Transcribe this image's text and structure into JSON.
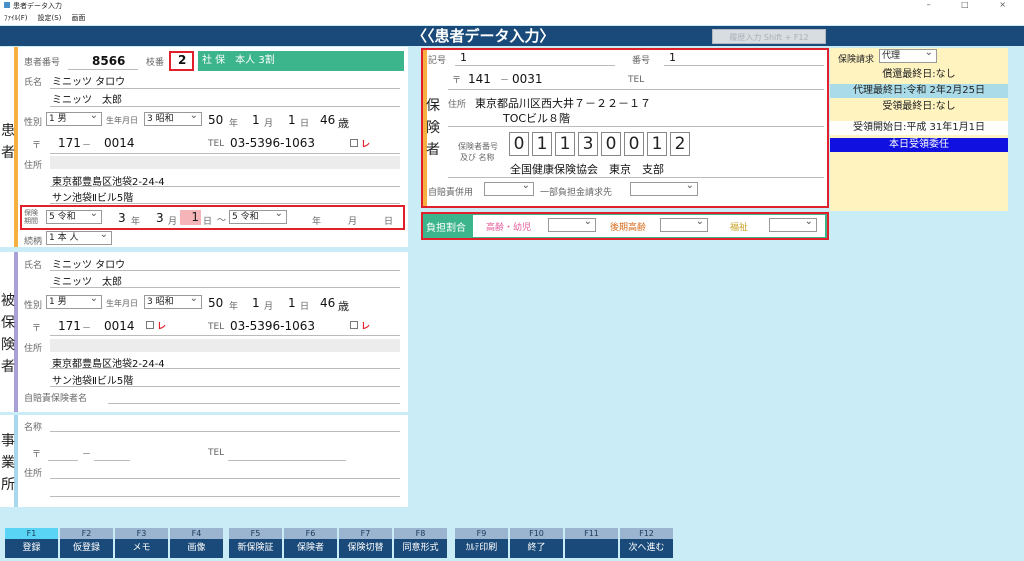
{
  "window": {
    "title": "患者データ入力",
    "controls": "– □ ×"
  },
  "menu": [
    "ﾌｧｲﾙ(F)",
    "設定(S)",
    "画面"
  ],
  "header": {
    "title": "〈〈患者データ入力〉",
    "history_button": "履歴入力 Shift + F12"
  },
  "patient": {
    "section": "患者",
    "no_label": "患者番号",
    "no": "8566",
    "branch_label": "枝番",
    "branch": "2",
    "insurance_badge": "社 保　本人 3割",
    "name_label": "氏名",
    "kana": "ミニッツ タロウ",
    "kanji": "ミニッツ　太郎",
    "sex_label": "性別",
    "sex": "1 男",
    "birth_label": "生年月日",
    "era": "3 昭和",
    "birth_year": "50",
    "year_unit": "年",
    "birth_month": "1",
    "month_unit": "月",
    "birth_day": "1",
    "day_unit": "日",
    "age": "46",
    "age_unit": "歳",
    "zip_mark": "〒",
    "zip1": "171",
    "dash": "－",
    "zip2": "0014",
    "tel_label": "TEL",
    "tel": "03-5396-1063",
    "check_mark": "レ",
    "addr_label": "住所",
    "addr1": "東京都豊島区池袋2-24-4",
    "addr2": "サン池袋Ⅱビル5階",
    "period_label": "保険期間",
    "period_era": "5 令和",
    "p_year": "3",
    "p_month": "3",
    "p_day": "1",
    "to_dash": "～",
    "end_era": "5 令和",
    "end_year_unit": "年",
    "end_month_unit": "月",
    "end_day_unit": "日",
    "relation_label": "続柄",
    "relation": "1 本 人"
  },
  "insured": {
    "section": "被保険者",
    "name_label": "氏名",
    "kana": "ミニッツ タロウ",
    "kanji": "ミニッツ　太郎",
    "sex_label": "性別",
    "sex": "1 男",
    "birth_label": "生年月日",
    "era": "3 昭和",
    "birth_year": "50",
    "year_unit": "年",
    "birth_month": "1",
    "month_unit": "月",
    "birth_day": "1",
    "day_unit": "日",
    "age": "46",
    "age_unit": "歳",
    "zip_mark": "〒",
    "zip1": "171",
    "dash": "－",
    "zip2": "0014",
    "tel_label": "TEL",
    "tel": "03-5396-1063",
    "check_mark": "レ",
    "addr_label": "住所",
    "addr1": "東京都豊島区池袋2-24-4",
    "addr2": "サン池袋Ⅱビル5階",
    "self_ins_label": "自賠責保険者名"
  },
  "workplace": {
    "section": "事業所",
    "name_label": "名称",
    "zip_mark": "〒",
    "dash": "－",
    "tel_label": "TEL",
    "addr_label": "住所"
  },
  "insurer": {
    "section": "保険者",
    "symbol_label": "記号",
    "symbol": "1",
    "number_label": "番号",
    "number": "1",
    "zip_mark": "〒",
    "zip1": "141",
    "dash": "－",
    "zip2": "0031",
    "tel_label": "TEL",
    "addr_label": "住所",
    "addr1": "東京都品川区西大井７－２２－１７",
    "addr2": "TOCビル８階",
    "ins_no_label1": "保険者番号",
    "ins_no_label2": "及び 名称",
    "digits": [
      "0",
      "1",
      "1",
      "3",
      "0",
      "0",
      "1",
      "2"
    ],
    "ins_name": "全国健康保険協会　東京　支部",
    "self_combo_label": "自賠責併用",
    "partial_label": "一部負担金請求先"
  },
  "burden": {
    "label": "負担割合",
    "elderly_child": "高齢・幼児",
    "late_elderly": "後期高齢",
    "welfare": "福祉"
  },
  "claims": {
    "request_label": "保険請求",
    "request_value": "代理",
    "repay_last": "償還最終日:なし",
    "proxy_last": "代理最終日:令和 2年2月25日",
    "receive_last": "受領最終日:なし",
    "receive_start": "受領開始日:平成 31年1月1日",
    "today_delegation": "本日受領委任"
  },
  "fkeys": [
    {
      "key": "F1",
      "label": "登録"
    },
    {
      "key": "F2",
      "label": "仮登録"
    },
    {
      "key": "F3",
      "label": "メモ"
    },
    {
      "key": "F4",
      "label": "画像"
    },
    {
      "key": "F5",
      "label": "新保険証"
    },
    {
      "key": "F6",
      "label": "保険者"
    },
    {
      "key": "F7",
      "label": "保険切替"
    },
    {
      "key": "F8",
      "label": "同意形式"
    },
    {
      "key": "F9",
      "label": "ｶﾙﾃ印刷"
    },
    {
      "key": "F10",
      "label": "終了"
    },
    {
      "key": "F11",
      "label": ""
    },
    {
      "key": "F12",
      "label": "次へ進む"
    }
  ],
  "colors": {
    "header": "#1a4a7a",
    "accent_green": "#3cb48c",
    "alert_red": "#e0202a",
    "claims_bg": "#fff3c0",
    "delegation_blue": "#1010e0",
    "proxy_bg": "#a9dbe8"
  }
}
